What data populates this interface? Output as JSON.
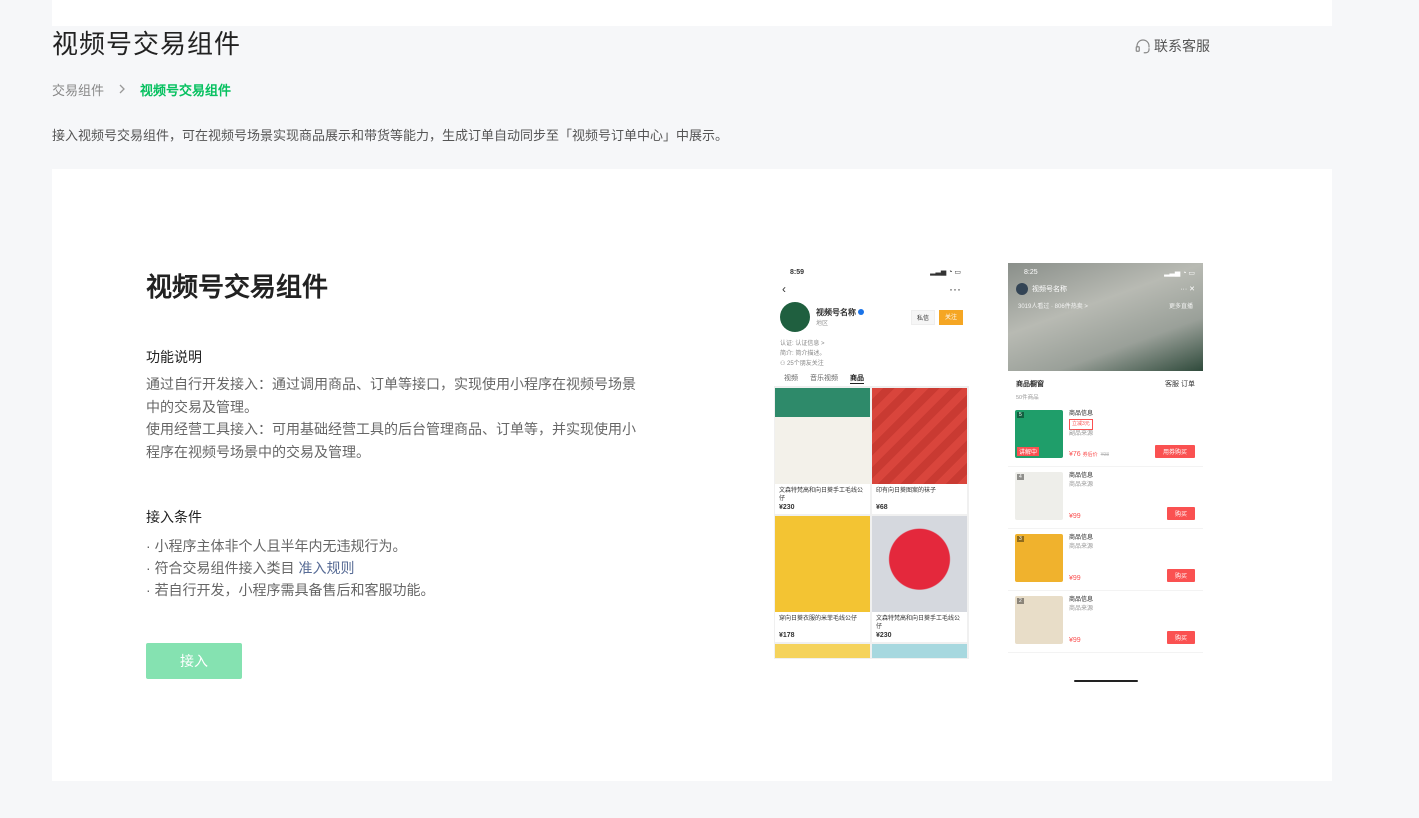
{
  "header": {
    "title": "视频号交易组件",
    "contact_label": "联系客服"
  },
  "breadcrumb": {
    "parent": "交易组件",
    "separator": ">",
    "current": "视频号交易组件"
  },
  "intro": "接入视频号交易组件，可在视频号场景实现商品展示和带货等能力，生成订单自动同步至「视频号订单中心」中展示。",
  "card": {
    "title": "视频号交易组件",
    "function_title": "功能说明",
    "function_lines": [
      "通过自行开发接入：通过调用商品、订单等接口，实现使用小程序在视频号场景中的交易及管理。",
      "使用经营工具接入：可用基础经营工具的后台管理商品、订单等，并实现使用小程序在视频号场景中的交易及管理。"
    ],
    "condition_title": "接入条件",
    "conditions": [
      "小程序主体非个人且半年内无违规行为。",
      "符合交易组件接入类目",
      "若自行开发，小程序需具备售后和客服功能。"
    ],
    "rule_link": "准入规则",
    "join_button": "接入"
  },
  "phone1": {
    "time": "8:59",
    "account_name": "视频号名称",
    "region": "地区",
    "msg_btn": "私信",
    "follow_btn": "关注",
    "meta": [
      "认证: 认证信息 >",
      "简介: 简介描述。",
      "25个朋友关注"
    ],
    "tabs": [
      "视频",
      "音乐视频",
      "商品"
    ],
    "products": [
      {
        "desc": "文森特梵高和向日葵手工毛线公仔",
        "price": "¥230",
        "color": "#2e8a6a"
      },
      {
        "desc": "印有向日葵图案的袜子",
        "price": "¥68",
        "color": "#d9453c"
      },
      {
        "desc": "穿向日葵衣服的米菲毛线公仔",
        "price": "¥178",
        "color": "#f3c433"
      },
      {
        "desc": "文森特梵高和向日葵手工毛线公仔",
        "price": "¥230",
        "color": "#d5d8de"
      }
    ]
  },
  "phone2": {
    "time": "8:25",
    "host_name": "视频号名称",
    "viewers": "3019人看过 · 806件热卖 >",
    "more_live": "更多直播",
    "shop_title": "商品橱窗",
    "shop_actions": "客服  订单",
    "count": "50件商品",
    "live_badge": "讲解中",
    "items": [
      {
        "idx": "5",
        "name": "商品信息",
        "sub": "副品来源",
        "tag": "立减3元",
        "price": "¥76",
        "price_note": "券后价",
        "orig": "¥98",
        "btn": "用券购买",
        "color": "#1f9e6a"
      },
      {
        "idx": "4",
        "name": "商品信息",
        "sub": "商品来源",
        "price": "¥99",
        "btn": "购买",
        "color": "#eeeeea"
      },
      {
        "idx": "3",
        "name": "商品信息",
        "sub": "商品来源",
        "price": "¥99",
        "btn": "购买",
        "color": "#f0b22d"
      },
      {
        "idx": "2",
        "name": "商品信息",
        "sub": "商品来源",
        "price": "¥99",
        "btn": "购买",
        "color": "#e8ddc8"
      }
    ]
  }
}
